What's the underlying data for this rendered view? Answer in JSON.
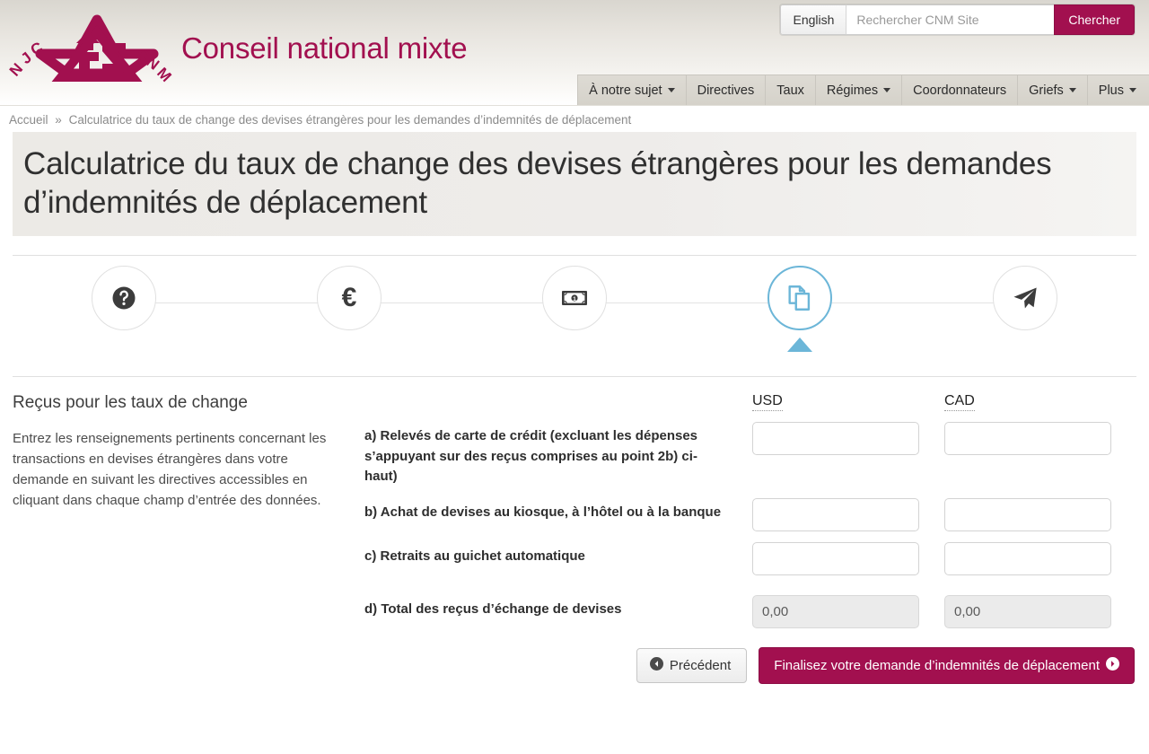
{
  "header": {
    "brand_name": "Conseil national mixte",
    "logo_left_text": "NJC",
    "logo_right_text": "CNM",
    "brand_color": "#A2104F",
    "language_toggle": "English",
    "search_placeholder": "Rechercher CNM Site",
    "search_value": "",
    "search_button": "Chercher",
    "nav_items": [
      {
        "label": "À notre sujet",
        "has_caret": true
      },
      {
        "label": "Directives",
        "has_caret": false
      },
      {
        "label": "Taux",
        "has_caret": false
      },
      {
        "label": "Régimes",
        "has_caret": true
      },
      {
        "label": "Coordonnateurs",
        "has_caret": false
      },
      {
        "label": "Griefs",
        "has_caret": true
      },
      {
        "label": "Plus",
        "has_caret": true
      }
    ]
  },
  "breadcrumb": {
    "home": "Accueil",
    "separator": "»",
    "current": "Calculatrice du taux de change des devises étrangères pour les demandes d’indemnités de déplacement"
  },
  "page": {
    "title": "Calculatrice du taux de change des devises étrangères pour les demandes d’indemnités de déplacement"
  },
  "stepper": {
    "active_index": 3,
    "active_color": "#6CB6D8",
    "inactive_color": "#e0e0e0",
    "steps": [
      {
        "icon": "question-circle-icon",
        "active": false
      },
      {
        "icon": "euro-sign-icon",
        "glyph": "€",
        "active": false
      },
      {
        "icon": "money-bill-icon",
        "active": false
      },
      {
        "icon": "copy-documents-icon",
        "active": true
      },
      {
        "icon": "paper-plane-icon",
        "active": false
      }
    ]
  },
  "content": {
    "section_heading": "Reçus pour les taux de change",
    "intro_paragraph": "Entrez les renseignements pertinents concernant les transactions en devises étrangères dans votre demande en suivant les directives accessibles en cliquant dans chaque champ d’entrée des données.",
    "currency_columns": [
      {
        "code": "USD"
      },
      {
        "code": "CAD"
      }
    ],
    "rows": [
      {
        "label": "a) Relevés de carte de crédit (excluant les dépenses s’appuyant sur des reçus comprises au point 2b) ci-haut)",
        "usd_value": "",
        "cad_value": "",
        "disabled": false
      },
      {
        "label": "b) Achat de devises au kiosque, à l’hôtel ou à la banque",
        "usd_value": "",
        "cad_value": "",
        "disabled": false
      },
      {
        "label": "c) Retraits au guichet automatique",
        "usd_value": "",
        "cad_value": "",
        "disabled": false
      },
      {
        "label": "d) Total des reçus d’échange de devises",
        "usd_value": "0,00",
        "cad_value": "0,00",
        "disabled": true
      }
    ]
  },
  "actions": {
    "prev_label": "Précédent",
    "next_label": "Finalisez votre demande d’indemnités de déplacement"
  }
}
